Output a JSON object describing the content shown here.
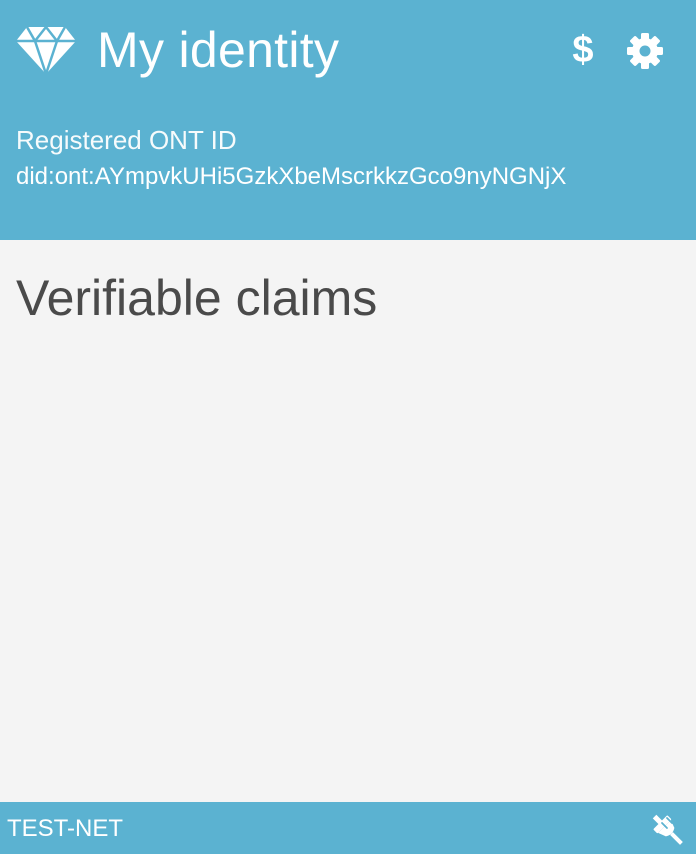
{
  "header": {
    "title": "My identity",
    "icons": {
      "logo": "diamond-icon",
      "currency": "dollar-icon",
      "settings": "gear-icon"
    },
    "dollar_glyph": "$",
    "ont_id_label": "Registered ONT ID",
    "ont_id_value": "did:ont:AYmpvkUHi5GzkXbeMscrkkzGco9nyNGNjX"
  },
  "main": {
    "section_title": "Verifiable claims"
  },
  "footer": {
    "network": "TEST-NET",
    "connection_icon": "plug-icon"
  },
  "colors": {
    "accent": "#5bb2d1",
    "background": "#f4f4f4",
    "heading_text": "#4a4a4a",
    "on_accent": "#ffffff"
  }
}
